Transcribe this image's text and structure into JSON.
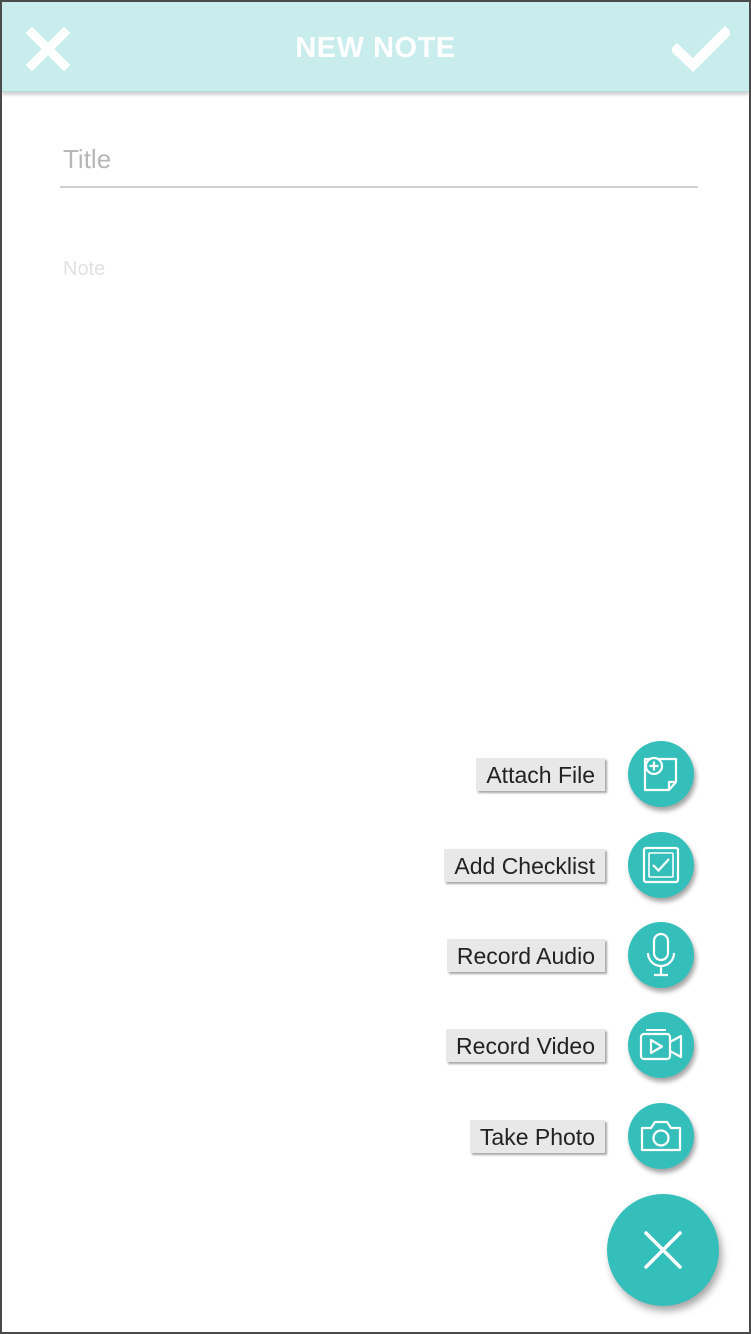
{
  "header": {
    "title": "NEW NOTE",
    "close_icon": "close-icon",
    "save_icon": "checkmark-icon",
    "background": "#c9ecec"
  },
  "form": {
    "title_placeholder": "Title",
    "title_value": "",
    "note_placeholder": "Note",
    "note_value": ""
  },
  "actions": [
    {
      "label": "Attach File",
      "icon": "attach-file-icon"
    },
    {
      "label": "Add Checklist",
      "icon": "checklist-icon"
    },
    {
      "label": "Record Audio",
      "icon": "microphone-icon"
    },
    {
      "label": "Record Video",
      "icon": "video-camera-icon"
    },
    {
      "label": "Take Photo",
      "icon": "camera-icon"
    }
  ],
  "fab": {
    "icon": "close-icon"
  },
  "colors": {
    "accent": "#35bfbb",
    "label_bg": "#e8e8e8"
  }
}
